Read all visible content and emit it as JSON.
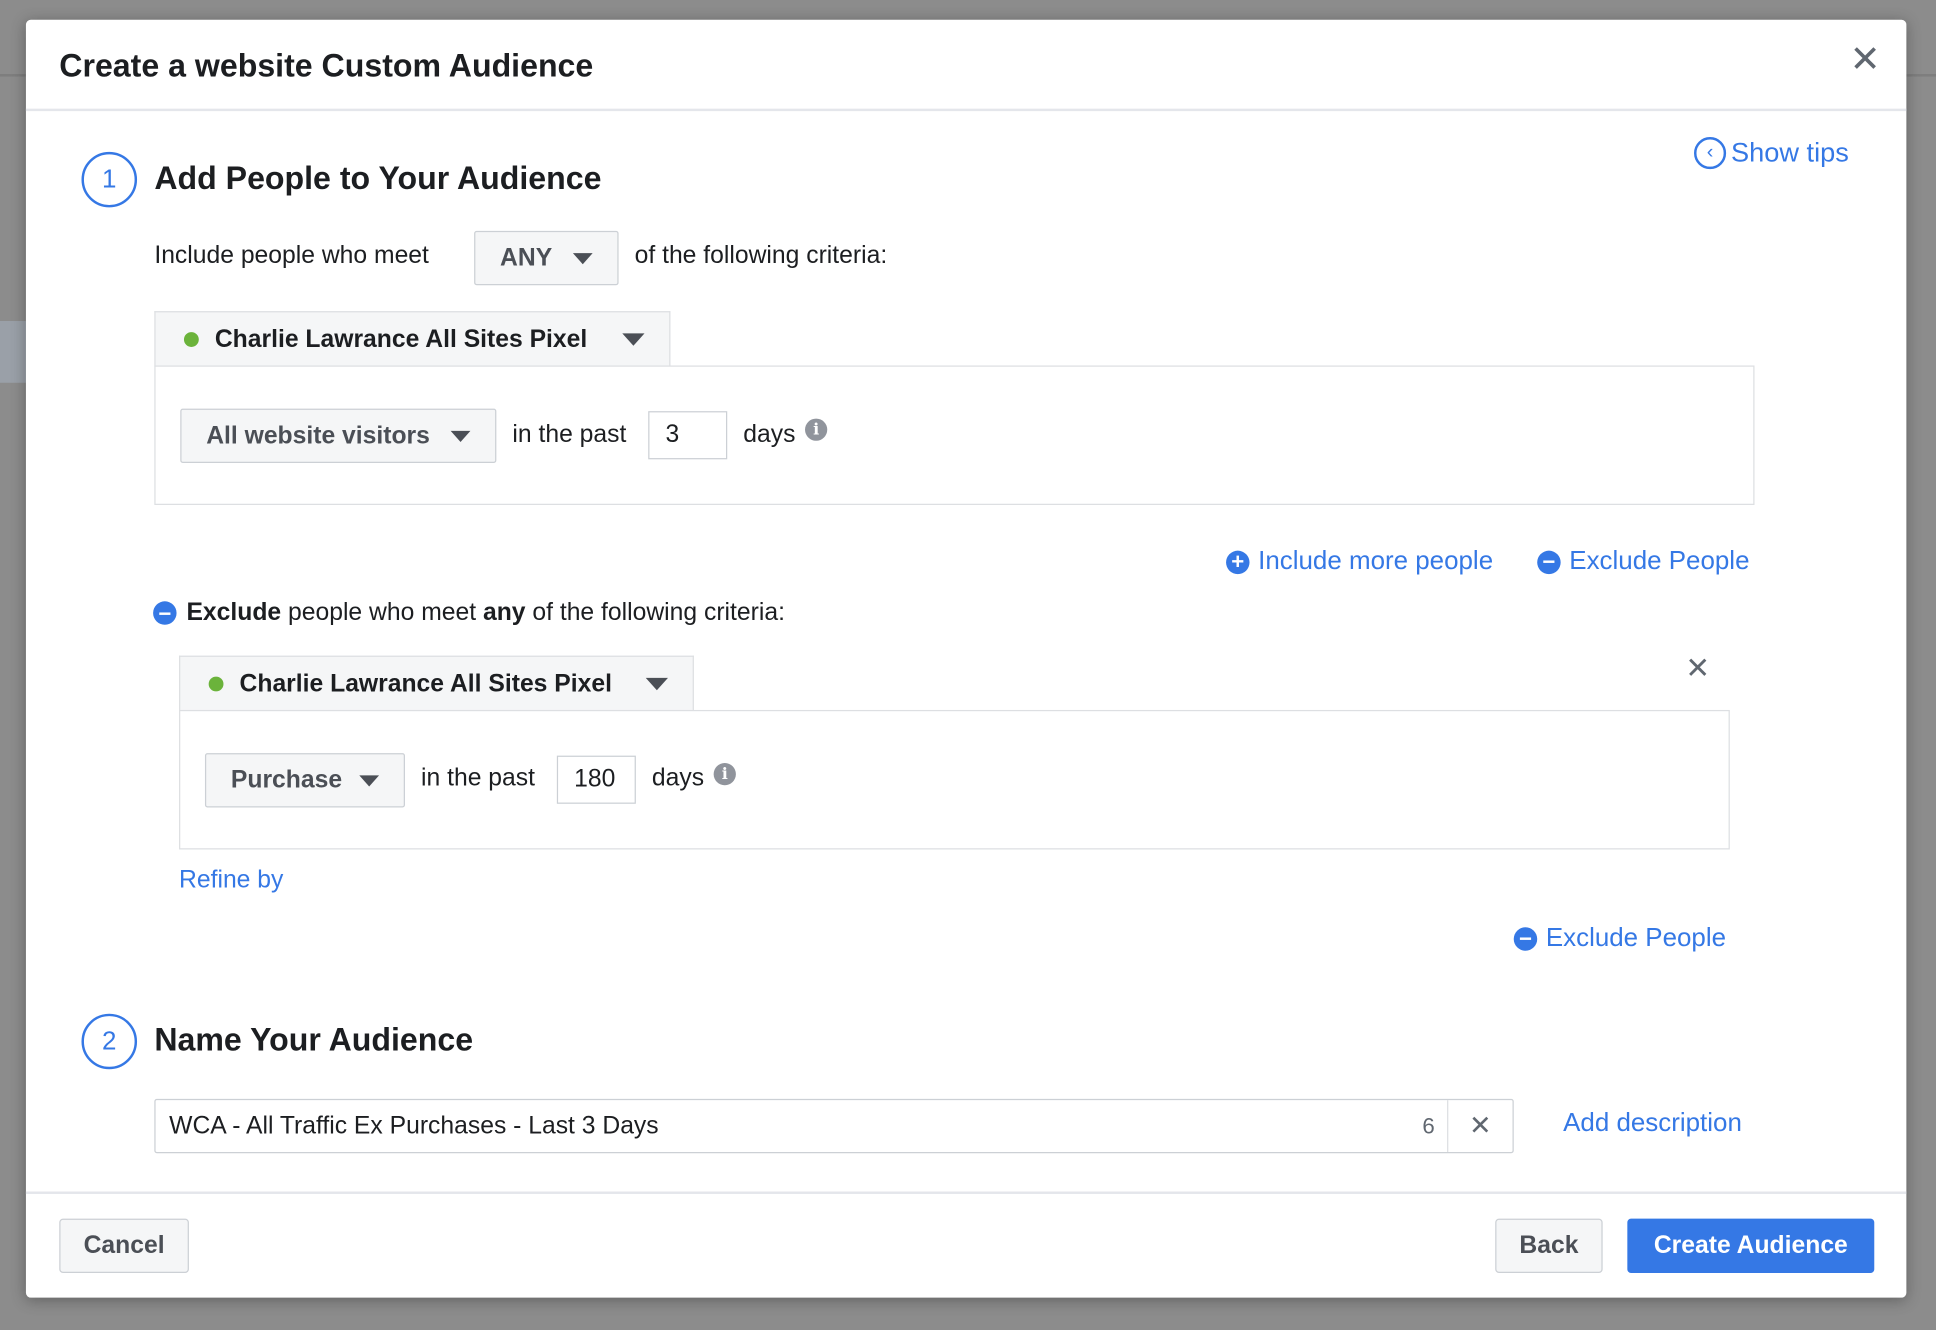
{
  "dialog": {
    "title": "Create a website Custom Audience",
    "close_icon": "close-icon"
  },
  "show_tips": {
    "label": "Show tips",
    "icon": "chevron-left-circle-icon"
  },
  "step1": {
    "number": "1",
    "heading": "Add People to Your Audience",
    "include_prefix": "Include people who meet",
    "match_select": "ANY",
    "include_suffix": "of the following criteria:",
    "include_rule": {
      "pixel": "Charlie Lawrance All Sites Pixel",
      "pixel_status_color": "#6bb33b",
      "event": "All website visitors",
      "in_the_past": "in the past",
      "days_value": "3",
      "days_label": "days"
    },
    "include_more_label": "Include more people",
    "exclude_people_label": "Exclude People",
    "exclude_header": {
      "bold1": "Exclude",
      "mid": "people who meet",
      "bold2": "any",
      "end": "of the following criteria:"
    },
    "exclude_rule": {
      "pixel": "Charlie Lawrance All Sites Pixel",
      "event": "Purchase",
      "in_the_past": "in the past",
      "days_value": "180",
      "days_label": "days"
    },
    "refine_by": "Refine by",
    "exclude_people_label_2": "Exclude People"
  },
  "step2": {
    "number": "2",
    "heading": "Name Your Audience",
    "name_value": "WCA - All Traffic Ex Purchases - Last 3 Days",
    "char_counter": "6",
    "add_description": "Add description"
  },
  "footer": {
    "cancel": "Cancel",
    "back": "Back",
    "create": "Create Audience"
  },
  "colors": {
    "accent": "#3578e5"
  }
}
